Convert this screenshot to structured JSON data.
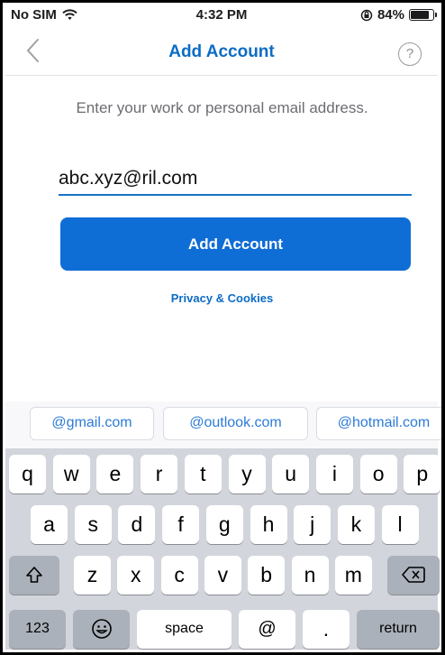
{
  "status_bar": {
    "carrier": "No SIM",
    "time": "4:32 PM",
    "battery": "84%",
    "battery_level": 0.84
  },
  "nav": {
    "title": "Add Account",
    "help_label": "?"
  },
  "instruction": "Enter your work or personal email address.",
  "email": {
    "value": "abc.xyz@ril.com"
  },
  "add_button": {
    "label": "Add Account"
  },
  "privacy_link": "Privacy & Cookies",
  "suggestions": [
    "@gmail.com",
    "@outlook.com",
    "@hotmail.com"
  ],
  "keyboard": {
    "row1": [
      "q",
      "w",
      "e",
      "r",
      "t",
      "y",
      "u",
      "i",
      "o",
      "p"
    ],
    "row2": [
      "a",
      "s",
      "d",
      "f",
      "g",
      "h",
      "j",
      "k",
      "l"
    ],
    "row3": [
      "z",
      "x",
      "c",
      "v",
      "b",
      "n",
      "m"
    ],
    "numbers_key": "123",
    "space_key": "space",
    "at_key": "@",
    "dot_key": ".",
    "return_key": "return",
    "shift_icon": "shift-icon",
    "backspace_icon": "backspace-icon",
    "emoji_icon": "emoji-icon"
  },
  "colors": {
    "accent": "#0c6cc5",
    "button": "#0f6dd6",
    "keyboard_bg": "#d2d5db"
  }
}
